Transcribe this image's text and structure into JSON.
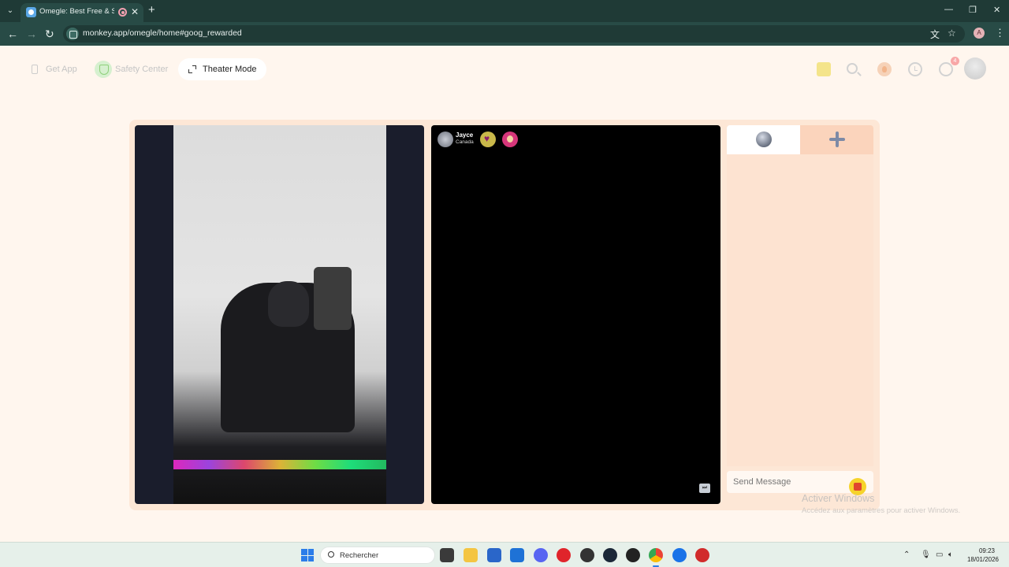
{
  "browser": {
    "tab_title": "Omegle: Best Free & Safe V",
    "url": "monkey.app/omegle/home#goog_rewarded"
  },
  "header": {
    "get_app_label": "Get App",
    "safety_center_label": "Safety Center",
    "theater_mode_label": "Theater Mode",
    "chat_badge_count": "4"
  },
  "remote_user": {
    "name": "Jayce",
    "country": "Canada"
  },
  "chat": {
    "placeholder": "Send Message"
  },
  "watermark": {
    "title": "Activer Windows",
    "subtitle": "Accédez aux paramètres pour activer Windows."
  },
  "taskbar": {
    "search_label": "Rechercher",
    "time": "09:23",
    "date": "18/01/2026"
  },
  "colors": {
    "page_bg": "#fff6ee",
    "stage_bg": "#fde7d6",
    "browser_chrome": "#284b46",
    "accent": "#2b7de9"
  }
}
